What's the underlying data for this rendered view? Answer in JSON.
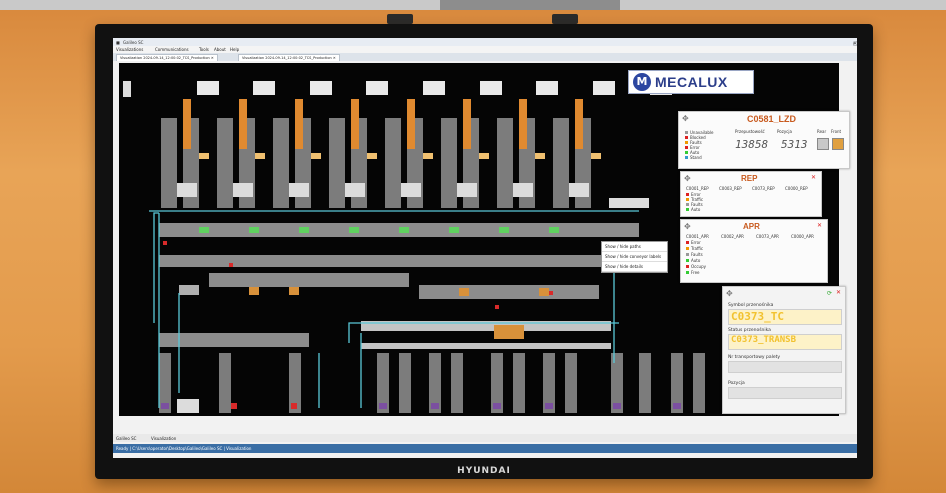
{
  "scene": {
    "tv_brand": "HYUNDAI"
  },
  "window": {
    "title": "Galileo SC",
    "menu": [
      "Visualizations",
      "Communications",
      "Tools",
      "About",
      "Help"
    ],
    "tabs": [
      "Visualization 2024-09-14_12:00:02_TCS_Production",
      "Visualization 2024-09-14_12:00:02_TCS_Production"
    ]
  },
  "brand_logo": {
    "text": "MECALUX",
    "mark": "M"
  },
  "panel_c0581": {
    "title": "C0581_LZD",
    "legend": [
      "Unavailable",
      "Blocked",
      "Faults",
      "Error",
      "Auto",
      "Stand"
    ],
    "column_labels": [
      "Przepustowość",
      "Pozycja",
      "Rear",
      "Front"
    ],
    "value_left": "13858",
    "value_right": "5313"
  },
  "panel_rep": {
    "title": "REP",
    "columns": [
      "C0001_REP",
      "C0003_REP",
      "C0073_REP",
      "C0000_REP"
    ],
    "rows": [
      "Error",
      "Traffic",
      "Faults",
      "Auto"
    ]
  },
  "panel_apr": {
    "title": "APR",
    "columns": [
      "C0001_APR",
      "C0002_APR",
      "C0073_APR",
      "C0000_APR"
    ],
    "rows": [
      "Error",
      "Traffic",
      "Faults",
      "Auto",
      "Occupy",
      "Free"
    ]
  },
  "panel_detail": {
    "label_symbol": "Symbol przenośnika",
    "value_symbol": "C0373_TC",
    "label_status": "Status przenośnika",
    "value_status": "C0373_TRANSB",
    "label_transport": "Nr transportowy palety",
    "label_position": "Pozycja"
  },
  "context_menu": [
    "Show / hide paths",
    "Show / hide conveyor labels",
    "Show / hide details"
  ],
  "bottom_tabs": [
    "Galileo SC",
    "Visualization"
  ],
  "status_bar": "Ready | C:\\Users\\operator\\Desktop\\Galileo\\Galileo SC | Visualization",
  "colors": {
    "wall": "#e39a4a",
    "bezel": "#111111",
    "canvas_bg": "#050505",
    "conveyor_gray": "#8c8c8c",
    "pallet_orange": "#d8913a",
    "path_cyan": "#5ac8d8",
    "status_green": "#3cc43c",
    "status_red": "#d82a2a",
    "accent_yellow": "#f2c230",
    "logo_blue": "#2c3e8a"
  }
}
